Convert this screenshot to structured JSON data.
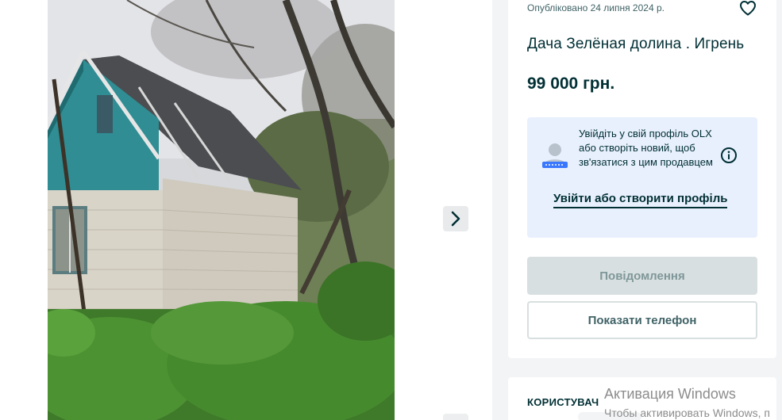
{
  "listing": {
    "published": "Опубліковано 24 липня 2024 р.",
    "title": "Дача Зелёная долина . Игрень",
    "price": "99 000 грн."
  },
  "login_prompt": {
    "text": "Увійдіть у свій профіль OLX або створіть новий, щоб зв'язатися з цим продавцем",
    "link_label": "Увійти або створити профіль"
  },
  "buttons": {
    "message": "Повідомлення",
    "show_phone": "Показати телефон"
  },
  "user_section": {
    "label": "КОРИСТУВАЧ"
  },
  "watermark": {
    "title": "Активация Windows",
    "subtitle": "Чтобы активировать Windows, п"
  },
  "icons": {
    "favorite": "heart-icon",
    "next": "chevron-right-icon",
    "info": "info-icon",
    "avatar": "user-avatar-icon"
  },
  "colors": {
    "brand_dark": "#002f34",
    "login_box_bg": "#e8f0fd",
    "disabled_button": "#d8dfe0"
  }
}
